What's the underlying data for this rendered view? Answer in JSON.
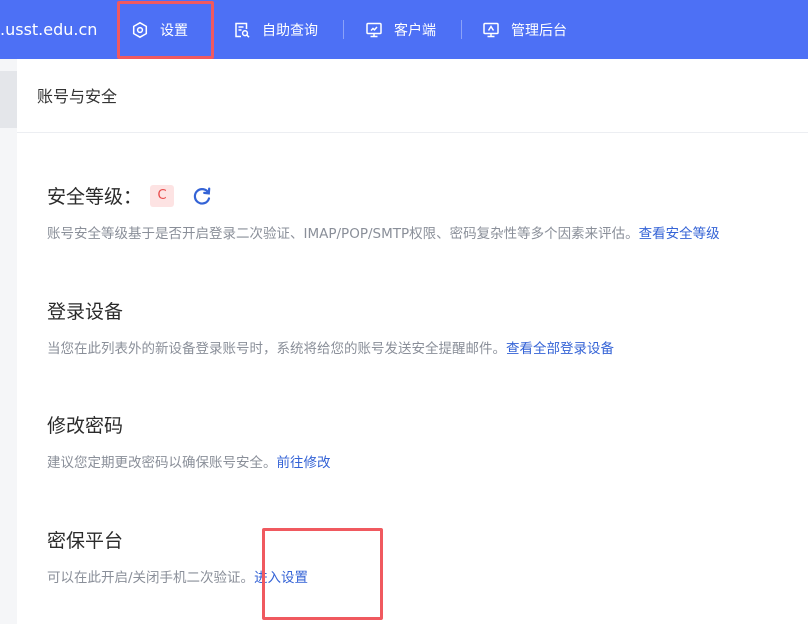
{
  "header": {
    "domain": ".usst.edu.cn",
    "nav": [
      {
        "label": "设置",
        "icon": "settings-hexagon-icon",
        "active": true
      },
      {
        "label": "自助查询",
        "icon": "document-search-icon"
      },
      {
        "label": "客户端",
        "icon": "monitor-icon"
      },
      {
        "label": "管理后台",
        "icon": "monitor-settings-icon"
      }
    ]
  },
  "page": {
    "title": "账号与安全"
  },
  "sections": {
    "security_level": {
      "title": "安全等级：",
      "level": "C",
      "description": "账号安全等级基于是否开启登录二次验证、IMAP/POP/SMTP权限、密码复杂性等多个因素来评估。",
      "link": "查看安全等级"
    },
    "login_devices": {
      "title": "登录设备",
      "description": "当您在此列表外的新设备登录账号时，系统将给您的账号发送安全提醒邮件。",
      "link": "查看全部登录设备"
    },
    "change_password": {
      "title": "修改密码",
      "description": "建议您定期更改密码以确保账号安全。",
      "link": "前往修改"
    },
    "security_platform": {
      "title": "密保平台",
      "description": "可以在此开启/关闭手机二次验证。",
      "link": "进入设置"
    }
  },
  "colors": {
    "topbar": "#4d70f5",
    "link": "#3463d6",
    "highlight": "#f0595f",
    "badge_bg": "#fde3e3",
    "badge_text": "#e84a4a"
  }
}
